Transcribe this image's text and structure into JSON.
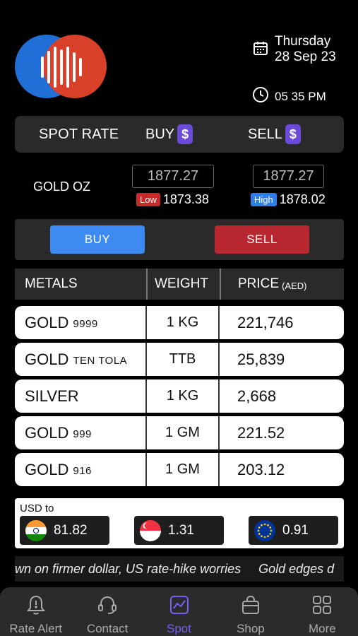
{
  "header": {
    "day": "Thursday",
    "date": "28 Sep 23",
    "time": "05 35 PM"
  },
  "spot_header": {
    "title": "SPOT RATE",
    "buy_label": "BUY",
    "sell_label": "SELL",
    "currency_symbol": "$"
  },
  "gold_oz": {
    "label": "GOLD OZ",
    "buy": "1877.27",
    "sell": "1877.27",
    "low_label": "Low",
    "low": "1873.38",
    "high_label": "High",
    "high": "1878.02"
  },
  "actions": {
    "buy": "BUY",
    "sell": "SELL"
  },
  "table": {
    "headers": {
      "metals": "METALS",
      "weight": "WEIGHT",
      "price": "PRICE",
      "price_unit": "(AED)"
    },
    "rows": [
      {
        "metal": "GOLD",
        "purity": "9999",
        "weight": "1 KG",
        "price": "221,746"
      },
      {
        "metal": "GOLD",
        "purity": "TEN TOLA",
        "weight": "TTB",
        "price": "25,839"
      },
      {
        "metal": "SILVER",
        "purity": "",
        "weight": "1 KG",
        "price": "2,668"
      },
      {
        "metal": "GOLD",
        "purity": "999",
        "weight": "1 GM",
        "price": "221.52"
      },
      {
        "metal": "GOLD",
        "purity": "916",
        "weight": "1 GM",
        "price": "203.12"
      }
    ]
  },
  "currency": {
    "label": "USD to",
    "rates": {
      "inr": "81.82",
      "sgd": "1.31",
      "eur": "0.91"
    }
  },
  "ticker": {
    "text": "wn on firmer dollar, US rate-hike worries     Gold edges d"
  },
  "nav": {
    "items": [
      {
        "label": "Rate Alert",
        "icon": "bell-icon"
      },
      {
        "label": "Contact",
        "icon": "headset-icon"
      },
      {
        "label": "Spot",
        "icon": "chart-icon"
      },
      {
        "label": "Shop",
        "icon": "bag-icon"
      },
      {
        "label": "More",
        "icon": "grid-icon"
      }
    ],
    "active": "Spot"
  },
  "colors": {
    "accent": "#7c5cf0",
    "buy": "#3d8bf2",
    "sell": "#b8272f",
    "logo_blue": "#1f6fd6",
    "logo_red": "#d9402a"
  }
}
